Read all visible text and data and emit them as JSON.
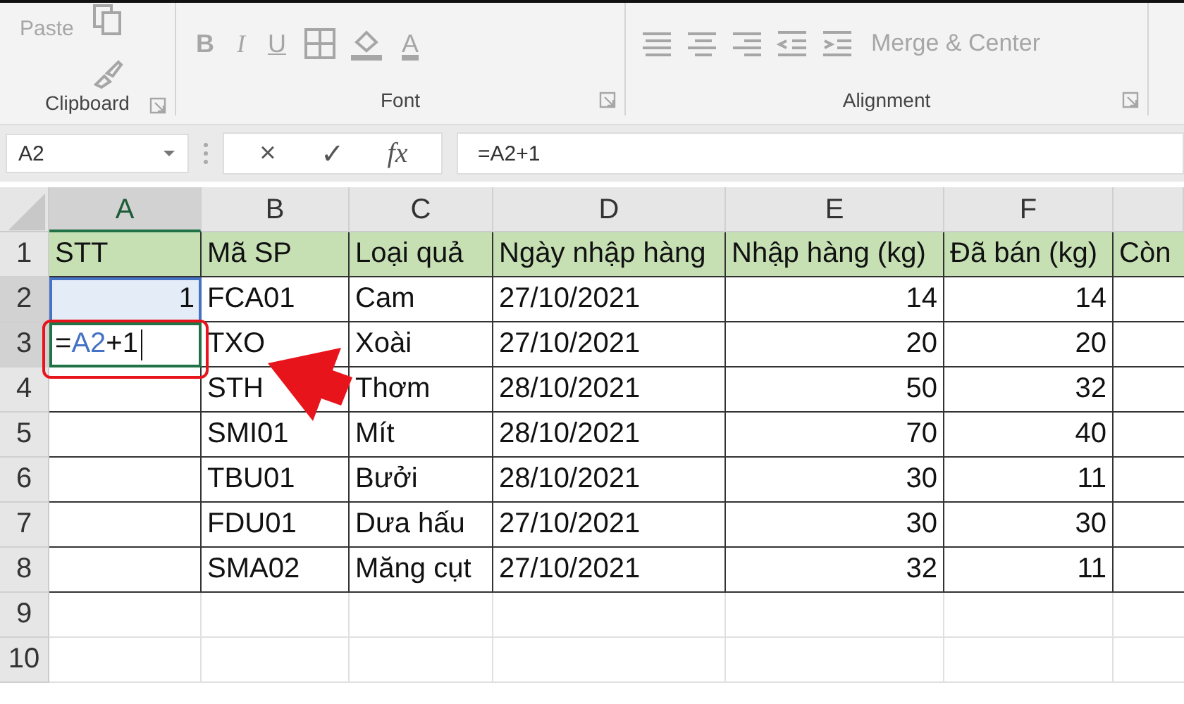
{
  "ribbon": {
    "disabled": true,
    "groups": [
      {
        "label": "Clipboard",
        "kind": "clipboard",
        "paste": "Paste"
      },
      {
        "label": "Font",
        "kind": "font",
        "bold": "B",
        "italic": "I",
        "underline": "U",
        "color_letter": "A"
      },
      {
        "label": "Alignment",
        "kind": "alignment",
        "merge": "Merge & Center"
      }
    ]
  },
  "formula_bar": {
    "name_box": "A2",
    "cancel": "×",
    "enter": "✓",
    "fx": "fx",
    "formula": "=A2+1"
  },
  "sheet": {
    "columns": [
      {
        "label": "A",
        "selected": true
      },
      {
        "label": "B",
        "selected": false
      },
      {
        "label": "C",
        "selected": false
      },
      {
        "label": "D",
        "selected": false
      },
      {
        "label": "E",
        "selected": false
      },
      {
        "label": "F",
        "selected": false
      },
      {
        "selected": false
      }
    ],
    "rows": [
      {
        "number": "1",
        "selected": false,
        "kind": "header",
        "cells": [
          "STT",
          "Mã SP",
          "Loại quả",
          "Ngày nhập hàng",
          "Nhập hàng (kg)",
          "Đã bán (kg)",
          "Còn"
        ]
      },
      {
        "number": "2",
        "selected": true,
        "kind": "data",
        "cells": [
          "1",
          "FCA01",
          "Cam",
          "27/10/2021",
          "14",
          "14",
          ""
        ]
      },
      {
        "number": "3",
        "selected": true,
        "kind": "data",
        "editing": [
          {
            "text": "=",
            "kind": "plain"
          },
          {
            "text": "A2",
            "kind": "reference"
          },
          {
            "text": "+1",
            "kind": "plain"
          }
        ],
        "cells": [
          "",
          "TXO",
          "Xoài",
          "27/10/2021",
          "20",
          "20",
          ""
        ]
      },
      {
        "number": "4",
        "selected": false,
        "kind": "data",
        "cells": [
          "",
          "STH",
          "Thơm",
          "28/10/2021",
          "50",
          "32",
          ""
        ]
      },
      {
        "number": "5",
        "selected": false,
        "kind": "data",
        "cells": [
          "",
          "SMI01",
          "Mít",
          "28/10/2021",
          "70",
          "40",
          ""
        ]
      },
      {
        "number": "6",
        "selected": false,
        "kind": "data",
        "cells": [
          "",
          "TBU01",
          "Bưởi",
          "28/10/2021",
          "30",
          "11",
          ""
        ]
      },
      {
        "number": "7",
        "selected": false,
        "kind": "data",
        "cells": [
          "",
          "FDU01",
          "Dưa hấu",
          "27/10/2021",
          "30",
          "30",
          ""
        ]
      },
      {
        "number": "8",
        "selected": false,
        "kind": "data",
        "cells": [
          "",
          "SMA02",
          "Măng cụt",
          "27/10/2021",
          "32",
          "11",
          ""
        ]
      },
      {
        "number": "9",
        "selected": false,
        "kind": "empty",
        "cells": []
      },
      {
        "number": "10",
        "selected": false,
        "kind": "empty",
        "cells": []
      }
    ]
  }
}
